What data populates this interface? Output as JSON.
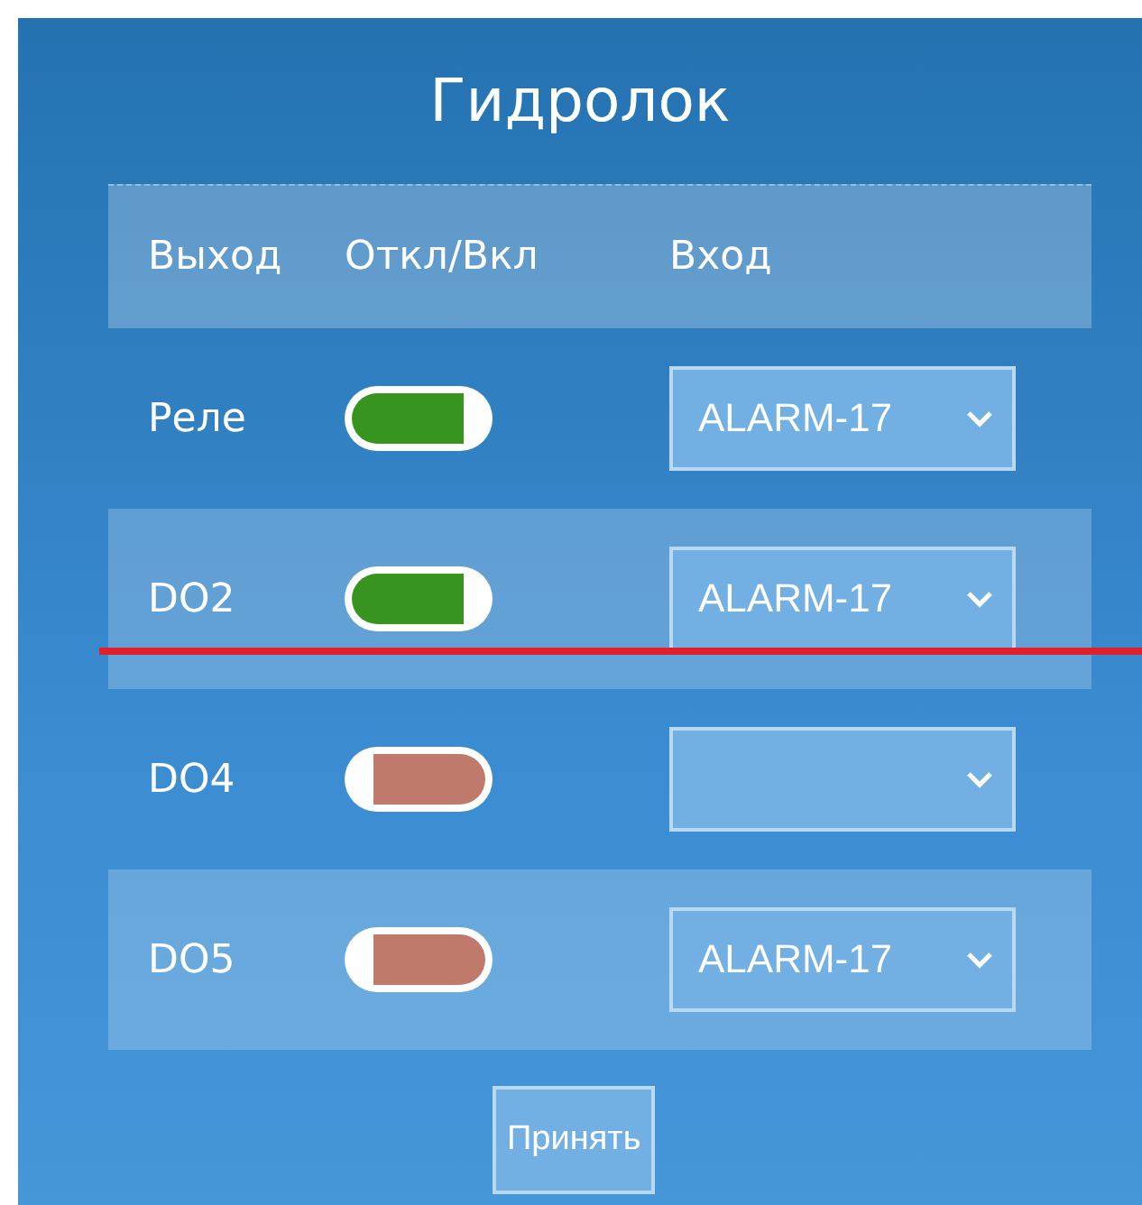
{
  "title": "Гидролок",
  "columns": [
    "Выход",
    "Откл/Вкл",
    "Вход"
  ],
  "rows": [
    {
      "output": "Реле",
      "on": true,
      "input": "ALARM-17"
    },
    {
      "output": "DO2",
      "on": true,
      "input": "ALARM-17"
    },
    {
      "output": "DO4",
      "on": false,
      "input": ""
    },
    {
      "output": "DO5",
      "on": false,
      "input": "ALARM-17"
    }
  ],
  "annotation_line": true,
  "submit": "Принять"
}
